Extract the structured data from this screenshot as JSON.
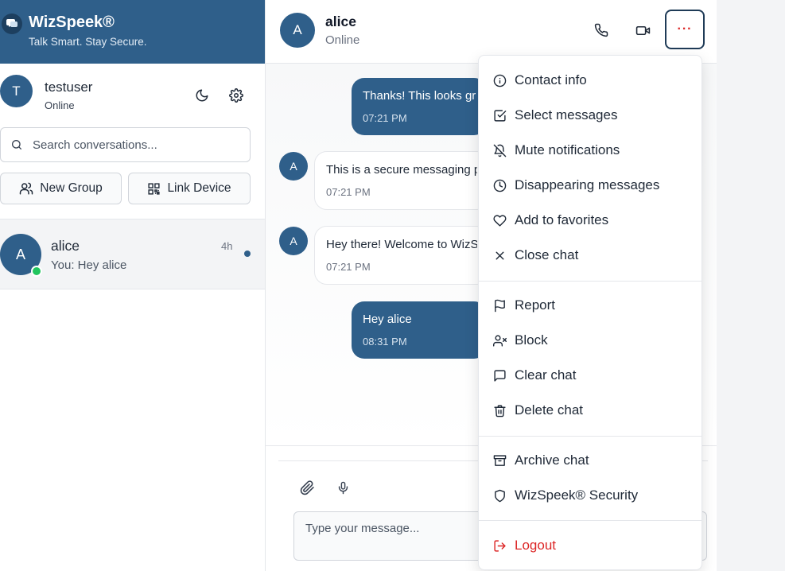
{
  "brand": {
    "name": "WizSpeek®",
    "tagline": "Talk Smart. Stay Secure."
  },
  "current_user": {
    "initial": "T",
    "name": "testuser",
    "status": "Online"
  },
  "search": {
    "placeholder": "Search conversations..."
  },
  "actions": {
    "new_group": "New Group",
    "link_device": "Link Device"
  },
  "conversations": [
    {
      "initial": "A",
      "name": "alice",
      "preview": "You: Hey alice",
      "time": "4h"
    }
  ],
  "chat": {
    "peer_initial": "A",
    "peer_name": "alice",
    "peer_status": "Online",
    "more_label": "···",
    "messages": [
      {
        "direction": "out",
        "text": "Thanks! This looks great",
        "time": "07:21 PM"
      },
      {
        "direction": "in",
        "initial": "A",
        "text": "This is a secure messaging platform",
        "time": "07:21 PM"
      },
      {
        "direction": "in",
        "initial": "A",
        "text": "Hey there! Welcome to WizSpeek",
        "time": "07:21 PM"
      },
      {
        "direction": "out",
        "text": "Hey alice",
        "time": "08:31 PM"
      }
    ],
    "composer_placeholder": "Type your message..."
  },
  "menu": {
    "items": [
      {
        "label": "Contact info",
        "icon": "info-icon"
      },
      {
        "label": "Select messages",
        "icon": "check-square-icon"
      },
      {
        "label": "Mute notifications",
        "icon": "bell-off-icon"
      },
      {
        "label": "Disappearing messages",
        "icon": "clock-icon"
      },
      {
        "label": "Add to favorites",
        "icon": "heart-icon"
      },
      {
        "label": "Close chat",
        "icon": "close-icon"
      },
      {
        "label": "Report",
        "icon": "flag-icon"
      },
      {
        "label": "Block",
        "icon": "user-x-icon"
      },
      {
        "label": "Clear chat",
        "icon": "message-square-icon"
      },
      {
        "label": "Delete chat",
        "icon": "trash-icon"
      },
      {
        "label": "Archive chat",
        "icon": "archive-icon"
      },
      {
        "label": "WizSpeek® Security",
        "icon": "shield-icon"
      },
      {
        "label": "Logout",
        "icon": "logout-icon"
      }
    ]
  },
  "colors": {
    "brand": "#2f5f8a",
    "danger": "#dc2626",
    "online": "#22c55e"
  }
}
